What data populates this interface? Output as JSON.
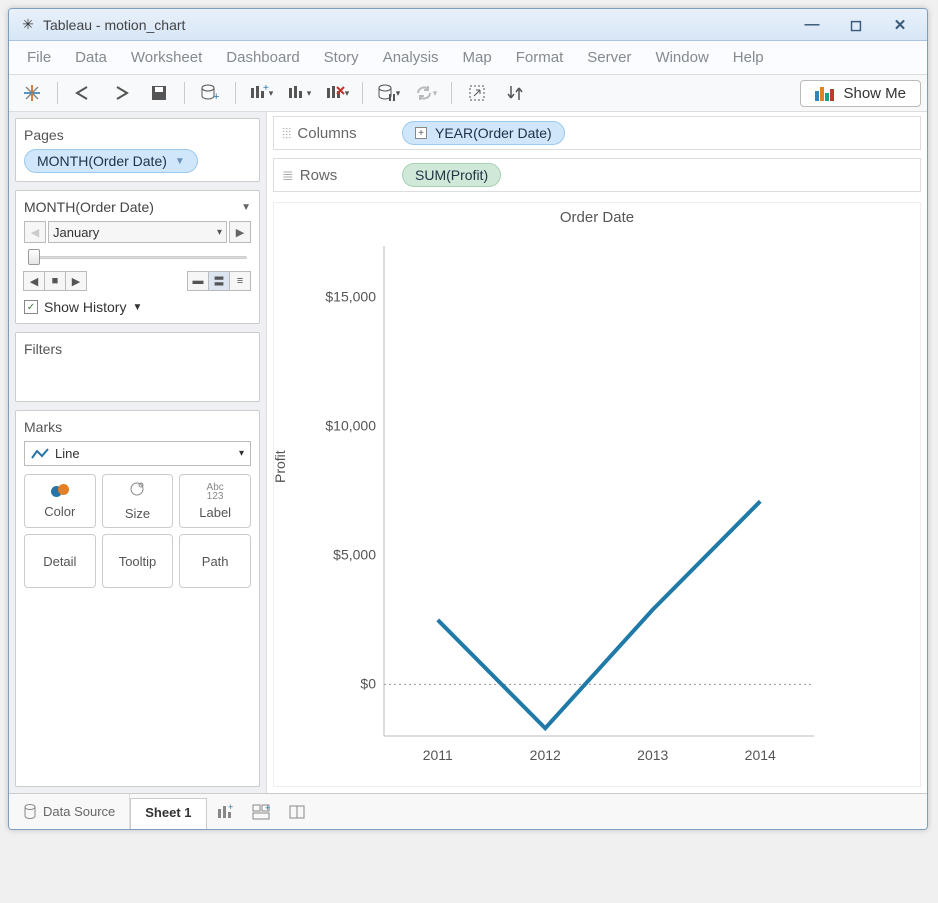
{
  "window": {
    "title": "Tableau - motion_chart"
  },
  "menu": [
    "File",
    "Data",
    "Worksheet",
    "Dashboard",
    "Story",
    "Analysis",
    "Map",
    "Format",
    "Server",
    "Window",
    "Help"
  ],
  "toolbar": {
    "show_me": "Show Me"
  },
  "pages": {
    "header": "Pages",
    "pill": "MONTH(Order Date)",
    "field_label": "MONTH(Order Date)",
    "current": "January",
    "show_history": "Show History"
  },
  "filters": {
    "header": "Filters"
  },
  "marks": {
    "header": "Marks",
    "type": "Line",
    "btns": {
      "color": "Color",
      "size": "Size",
      "label": "Label",
      "detail": "Detail",
      "tooltip": "Tooltip",
      "path": "Path"
    },
    "label_ic_top": "Abc",
    "label_ic_bot": "123"
  },
  "shelves": {
    "columns_label": "Columns",
    "rows_label": "Rows",
    "columns_pill": "YEAR(Order Date)",
    "rows_pill": "SUM(Profit)"
  },
  "tabs": {
    "data_source": "Data Source",
    "sheet": "Sheet 1"
  },
  "chart_data": {
    "type": "line",
    "title": "Order Date",
    "ylabel": "Profit",
    "ylim": [
      -2000,
      17000
    ],
    "yticks": [
      0,
      5000,
      10000,
      15000
    ],
    "yticklabels": [
      "$0",
      "$5,000",
      "$10,000",
      "$15,000"
    ],
    "categories": [
      "2011",
      "2012",
      "2013",
      "2014"
    ],
    "values": [
      2500,
      -1700,
      2900,
      7100
    ],
    "color": "#1f7aa8"
  }
}
